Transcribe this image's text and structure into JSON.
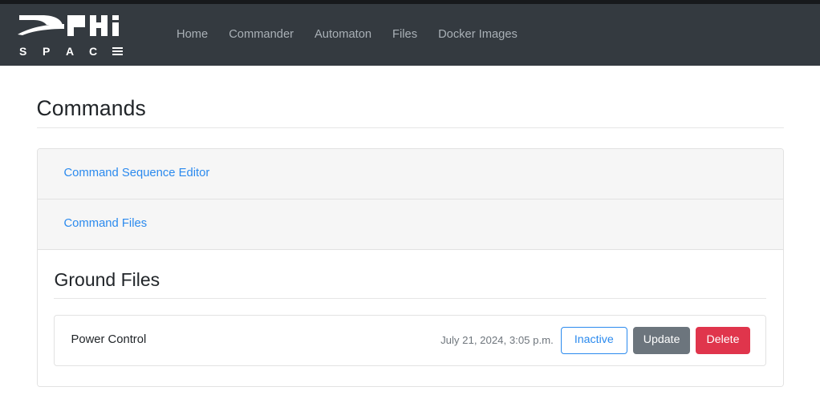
{
  "brand": {
    "name": "DPHi",
    "sub_letters": [
      "S",
      "P",
      "A",
      "C"
    ],
    "sub_last_icon": "bars-glyph",
    "full_text": "DPHi SPACE"
  },
  "navbar": {
    "background": "#343a40",
    "link_color": "#a9b0b6",
    "links": [
      {
        "label": "Home"
      },
      {
        "label": "Commander"
      },
      {
        "label": "Automaton"
      },
      {
        "label": "Files"
      },
      {
        "label": "Docker Images"
      }
    ]
  },
  "page": {
    "title": "Commands"
  },
  "accordion": {
    "items": [
      {
        "label": "Command Sequence Editor",
        "expanded": false
      },
      {
        "label": "Command Files",
        "expanded": true
      }
    ],
    "link_color": "#2b8aee"
  },
  "ground_files": {
    "section_title": "Ground Files",
    "rows": [
      {
        "name": "Power Control",
        "timestamp": "July 21, 2024, 3:05 p.m.",
        "status_label": "Inactive",
        "update_label": "Update",
        "delete_label": "Delete"
      }
    ]
  },
  "colors": {
    "primary": "#2b8aee",
    "secondary": "#6c757d",
    "danger": "#e0354c",
    "navbar_dark": "#343a40",
    "top_strip": "#17191c",
    "card_header_bg": "#f6f6f6",
    "border": "#e2e2e2"
  }
}
